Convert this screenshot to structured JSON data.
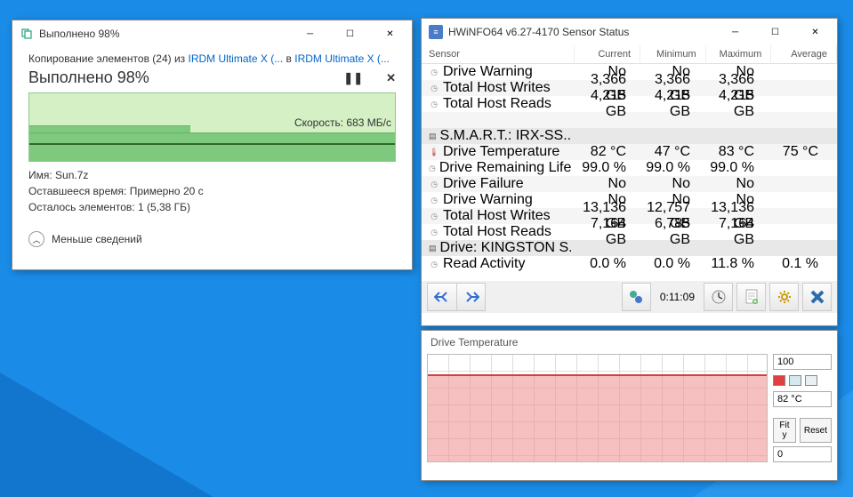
{
  "copy": {
    "title_bar": "Выполнено 98%",
    "line1_a": "Копирование элементов (24) из ",
    "link1": "IRDM Ultimate X (...",
    "line1_b": " в ",
    "link2": "IRDM Ultimate X (...",
    "heading": "Выполнено 98%",
    "pause_glyph": "❚❚",
    "close_glyph": "✕",
    "speed": "Скорость: 683 МБ/с",
    "name_label": "Имя: ",
    "name_value": "Sun.7z",
    "time_label": "Оставшееся время: ",
    "time_value": "Примерно 20 с",
    "items_label": "Осталось элементов: ",
    "items_value": "1 (5,38 ГБ)",
    "less": "Меньше сведений"
  },
  "hw": {
    "title": "HWiNFO64 v6.27-4170 Sensor Status",
    "headers": {
      "sensor": "Sensor",
      "cur": "Current",
      "min": "Minimum",
      "max": "Maximum",
      "avg": "Average"
    },
    "rows": [
      {
        "icon": "clock",
        "name": "Drive Warning",
        "cur": "No",
        "min": "No",
        "max": "No",
        "avg": ""
      },
      {
        "icon": "clock",
        "name": "Total Host Writes",
        "cur": "3,366 GB",
        "min": "3,366 GB",
        "max": "3,366 GB",
        "avg": ""
      },
      {
        "icon": "clock",
        "name": "Total Host Reads",
        "cur": "4,215 GB",
        "min": "4,215 GB",
        "max": "4,215 GB",
        "avg": ""
      },
      {
        "section": true,
        "icon": "drive",
        "name": "S.M.A.R.T.: IRX-SS..."
      },
      {
        "icon": "temp",
        "name": "Drive Temperature",
        "cur": "82 °C",
        "min": "47 °C",
        "max": "83 °C",
        "avg": "75 °C"
      },
      {
        "icon": "clock",
        "name": "Drive Remaining Life",
        "cur": "99.0 %",
        "min": "99.0 %",
        "max": "99.0 %",
        "avg": ""
      },
      {
        "icon": "clock",
        "name": "Drive Failure",
        "cur": "No",
        "min": "No",
        "max": "No",
        "avg": ""
      },
      {
        "icon": "clock",
        "name": "Drive Warning",
        "cur": "No",
        "min": "No",
        "max": "No",
        "avg": ""
      },
      {
        "icon": "clock",
        "name": "Total Host Writes",
        "cur": "13,136 GB",
        "min": "12,757 GB",
        "max": "13,136 GB",
        "avg": ""
      },
      {
        "icon": "clock",
        "name": "Total Host Reads",
        "cur": "7,164 GB",
        "min": "6,785 GB",
        "max": "7,164 GB",
        "avg": ""
      },
      {
        "section": true,
        "icon": "drive",
        "name": "Drive: KINGSTON S..."
      },
      {
        "icon": "clock",
        "name": "Read Activity",
        "cur": "0.0 %",
        "min": "0.0 %",
        "max": "11.8 %",
        "avg": "0.1 %"
      }
    ],
    "elapsed": "0:11:09"
  },
  "temp": {
    "title": "Drive Temperature",
    "ymax": "100",
    "current": "82 °C",
    "fity": "Fit y",
    "reset": "Reset",
    "ymin": "0"
  },
  "chart_data": {
    "type": "line",
    "title": "Drive Temperature",
    "ylabel": "°C",
    "ylim": [
      0,
      100
    ],
    "current_value": 82,
    "series": [
      {
        "name": "Drive Temperature",
        "color": "#e04040",
        "values": [
          78,
          78,
          79,
          79,
          79,
          80,
          80,
          80,
          80,
          80,
          80,
          80,
          80,
          80,
          81,
          81,
          81,
          81,
          82,
          82,
          82,
          82,
          83,
          83,
          83,
          82,
          82
        ]
      }
    ]
  }
}
